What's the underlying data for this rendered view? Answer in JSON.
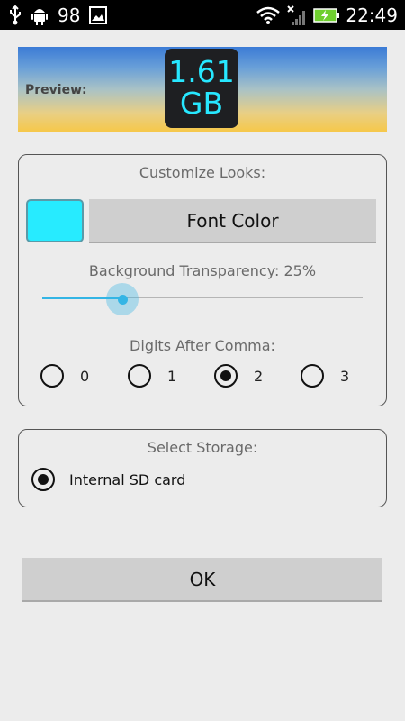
{
  "status_bar": {
    "battery_level_text": "98",
    "time": "22:49",
    "icons": [
      "usb-icon",
      "android-debug-icon",
      "image-icon",
      "wifi-icon",
      "signal-icon",
      "battery-charging-icon"
    ]
  },
  "preview": {
    "label": "Preview:",
    "widget_value": "1.61",
    "widget_unit": "GB",
    "widget_text_color": "#27e7ff"
  },
  "customize": {
    "title": "Customize Looks:",
    "font_color_swatch": "#27ebff",
    "font_color_button": "Font Color",
    "transparency_label": "Background Transparency: 25%",
    "transparency_value": 0.25,
    "digits_label": "Digits After Comma:",
    "digits_options": [
      "0",
      "1",
      "2",
      "3"
    ],
    "digits_selected": "2"
  },
  "storage": {
    "title": "Select Storage:",
    "options": [
      "Internal SD card"
    ],
    "selected": "Internal SD card"
  },
  "ok_button": "OK",
  "colors": {
    "accent": "#33b5e5",
    "button_bg": "#cfcfcf",
    "page_bg": "#ececec"
  }
}
